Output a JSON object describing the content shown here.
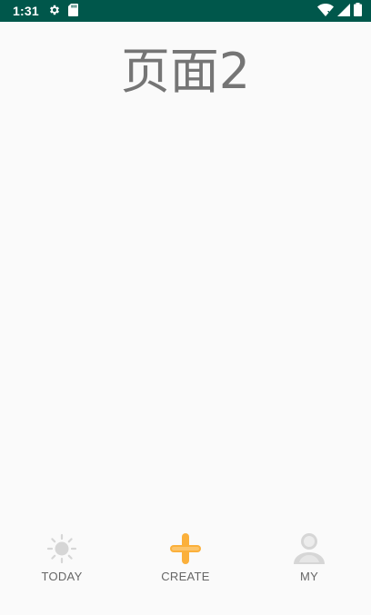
{
  "status_bar": {
    "time": "1:31",
    "left_icons": [
      "gear-icon",
      "sd-card-icon"
    ],
    "right_icons": [
      "wifi-icon",
      "signal-icon",
      "battery-icon"
    ],
    "background": "#00574b"
  },
  "page": {
    "title": "页面2",
    "background": "#fafafa"
  },
  "bottom_nav": {
    "items": [
      {
        "label": "TODAY",
        "icon": "sun-icon",
        "selected": false
      },
      {
        "label": "CREATE",
        "icon": "plus-icon",
        "selected": true
      },
      {
        "label": "MY",
        "icon": "person-icon",
        "selected": false
      }
    ],
    "active_color": "#fbb03b",
    "inactive_color": "#d6d6d6",
    "label_color": "#666666"
  }
}
